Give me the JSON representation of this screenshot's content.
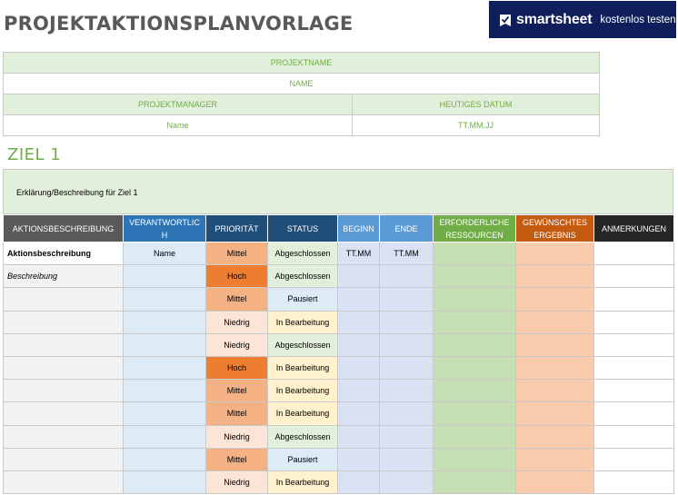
{
  "header": {
    "title": "PROJEKTAKTIONSPLANVORLAGE",
    "brand": {
      "name": "smartsheet",
      "cta": "kostenlos testen",
      "icon": "smartsheet-check-icon"
    }
  },
  "project_info": {
    "project_name_label": "PROJEKTNAME",
    "project_name_value": "NAME",
    "manager_label": "PROJEKTMANAGER",
    "manager_value": "Name",
    "date_label": "HEUTIGES DATUM",
    "date_value": "TT.MM.JJ"
  },
  "goal": {
    "title": "ZIEL 1",
    "description": "Erklärung/Beschreibung für Ziel 1"
  },
  "columns": [
    {
      "label": "AKTIONSBESCHREIBUNG",
      "color": "#595959"
    },
    {
      "label": "VERANTWORTLIC H",
      "color": "#2e75b6"
    },
    {
      "label": "PRIORITÄT",
      "color": "#1f4e79"
    },
    {
      "label": "STATUS",
      "color": "#1f4e79"
    },
    {
      "label": "BEGINN",
      "color": "#5b9bd5"
    },
    {
      "label": "ENDE",
      "color": "#5b9bd5"
    },
    {
      "label": "ERFORDERLICHE RESSOURCEN",
      "color": "#70ad47"
    },
    {
      "label": "GEWÜNSCHTES ERGEBNIS",
      "color": "#c55a11"
    },
    {
      "label": "ANMERKUNGEN",
      "color": "#262626"
    }
  ],
  "priority_colors": {
    "Hoch": "#ed7d31",
    "Mittel": "#f4b183",
    "Niedrig": "#fbe5d6"
  },
  "status_colors": {
    "Abgeschlossen": "#e2efda",
    "Pausiert": "#ddebf7",
    "In Bearbeitung": "#fff2cc"
  },
  "rows": [
    {
      "action": "Aktionsbeschreibung",
      "responsible": "Name",
      "priority": "Mittel",
      "status": "Abgeschlossen",
      "start": "TT.MM",
      "end": "TT.MM",
      "resources": "",
      "result": "",
      "notes": ""
    },
    {
      "action": "Beschreibung",
      "responsible": "",
      "priority": "Hoch",
      "status": "Abgeschlossen",
      "start": "",
      "end": "",
      "resources": "",
      "result": "",
      "notes": ""
    },
    {
      "action": "",
      "responsible": "",
      "priority": "Mittel",
      "status": "Pausiert",
      "start": "",
      "end": "",
      "resources": "",
      "result": "",
      "notes": ""
    },
    {
      "action": "",
      "responsible": "",
      "priority": "Niedrig",
      "status": "In Bearbeitung",
      "start": "",
      "end": "",
      "resources": "",
      "result": "",
      "notes": ""
    },
    {
      "action": "",
      "responsible": "",
      "priority": "Niedrig",
      "status": "Abgeschlossen",
      "start": "",
      "end": "",
      "resources": "",
      "result": "",
      "notes": ""
    },
    {
      "action": "",
      "responsible": "",
      "priority": "Hoch",
      "status": "In Bearbeitung",
      "start": "",
      "end": "",
      "resources": "",
      "result": "",
      "notes": ""
    },
    {
      "action": "",
      "responsible": "",
      "priority": "Mittel",
      "status": "In Bearbeitung",
      "start": "",
      "end": "",
      "resources": "",
      "result": "",
      "notes": ""
    },
    {
      "action": "",
      "responsible": "",
      "priority": "Mittel",
      "status": "In Bearbeitung",
      "start": "",
      "end": "",
      "resources": "",
      "result": "",
      "notes": ""
    },
    {
      "action": "",
      "responsible": "",
      "priority": "Niedrig",
      "status": "Abgeschlossen",
      "start": "",
      "end": "",
      "resources": "",
      "result": "",
      "notes": ""
    },
    {
      "action": "",
      "responsible": "",
      "priority": "Mittel",
      "status": "Pausiert",
      "start": "",
      "end": "",
      "resources": "",
      "result": "",
      "notes": ""
    },
    {
      "action": "",
      "responsible": "",
      "priority": "Niedrig",
      "status": "In Bearbeitung",
      "start": "",
      "end": "",
      "resources": "",
      "result": "",
      "notes": ""
    }
  ]
}
